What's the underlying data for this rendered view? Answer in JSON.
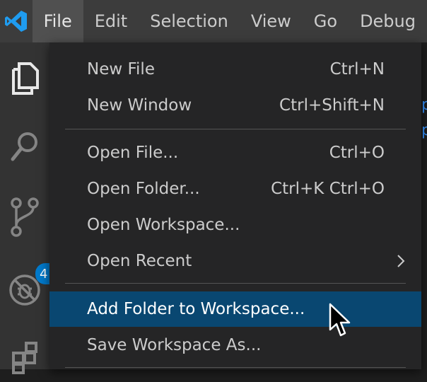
{
  "menubar": {
    "logo_icon": "vscode-logo-icon",
    "items": [
      {
        "label": "File"
      },
      {
        "label": "Edit"
      },
      {
        "label": "Selection"
      },
      {
        "label": "View"
      },
      {
        "label": "Go"
      },
      {
        "label": "Debug"
      }
    ],
    "active_index": 0
  },
  "activitybar": {
    "icons": [
      "explorer-icon",
      "search-icon",
      "source-control-icon",
      "debug-icon",
      "extensions-icon"
    ],
    "source_control_badge": "4"
  },
  "file_menu": {
    "items": [
      {
        "label": "New File",
        "shortcut": "Ctrl+N"
      },
      {
        "label": "New Window",
        "shortcut": "Ctrl+Shift+N"
      },
      {
        "label": "Open File...",
        "shortcut": "Ctrl+O"
      },
      {
        "label": "Open Folder...",
        "shortcut": "Ctrl+K Ctrl+O"
      },
      {
        "label": "Open Workspace...",
        "shortcut": ""
      },
      {
        "label": "Open Recent",
        "shortcut": "",
        "submenu": true
      },
      {
        "label": "Add Folder to Workspace...",
        "shortcut": "",
        "highlighted": true
      },
      {
        "label": "Save Workspace As...",
        "shortcut": ""
      }
    ]
  },
  "editor_peek": {
    "chars": [
      "p",
      "p"
    ]
  },
  "colors": {
    "menubar_bg": "#3c3c3c",
    "menu_bg": "#252526",
    "highlight_bg": "#094771",
    "accent": "#007acc",
    "text": "#cccccc"
  }
}
